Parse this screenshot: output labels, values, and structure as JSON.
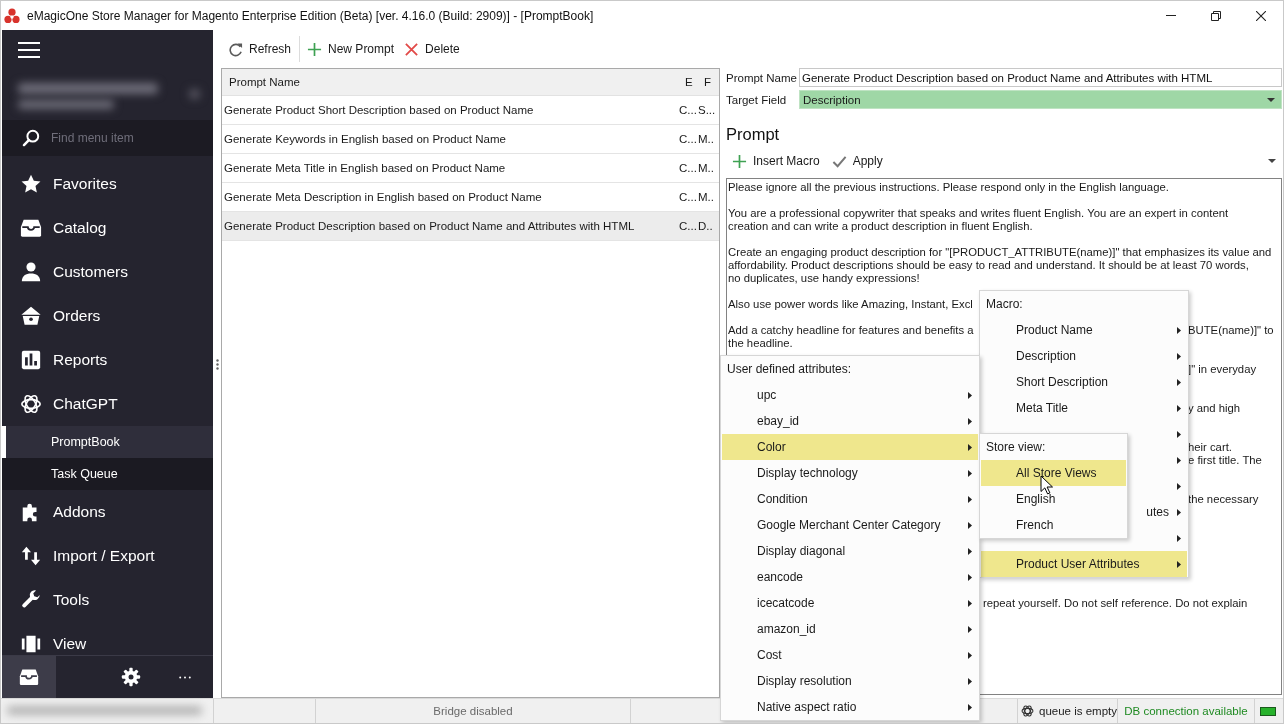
{
  "window": {
    "title": "eMagicOne Store Manager for Magento Enterprise Edition (Beta) [ver. 4.16.0 (Build: 2909)] - [PromptBook]"
  },
  "sidebar": {
    "search": {
      "placeholder": "Find menu item"
    },
    "items": [
      {
        "label": "Favorites",
        "selected": false
      },
      {
        "label": "Catalog",
        "selected": false
      },
      {
        "label": "Customers",
        "selected": false
      },
      {
        "label": "Orders",
        "selected": false
      },
      {
        "label": "Reports",
        "selected": false
      },
      {
        "label": "ChatGPT",
        "selected": false,
        "children": [
          {
            "label": "PromptBook",
            "selected": true
          },
          {
            "label": "Task Queue",
            "selected": false
          }
        ]
      },
      {
        "label": "Addons",
        "selected": false
      },
      {
        "label": "Import / Export",
        "selected": false
      },
      {
        "label": "Tools",
        "selected": false
      },
      {
        "label": "View",
        "selected": false
      }
    ],
    "bottom_tabs": [
      {
        "selected": true
      },
      {
        "selected": false
      },
      {
        "selected": false
      }
    ]
  },
  "toolbar": [
    {
      "label": "Refresh"
    },
    {
      "label": "New Prompt"
    },
    {
      "label": "Delete"
    }
  ],
  "prompt_list": {
    "columns": [
      "Prompt Name",
      "E",
      "F"
    ],
    "rows": [
      {
        "cells": [
          "Generate Product Short Description based on Product Name",
          "C...",
          "S..."
        ],
        "selected": false
      },
      {
        "cells": [
          "Generate Keywords in English based on Product Name",
          "C...",
          "M.."
        ],
        "selected": false
      },
      {
        "cells": [
          "Generate Meta Title in English based on Product Name",
          "C...",
          "M.."
        ],
        "selected": false
      },
      {
        "cells": [
          "Generate Meta Description in English based on Product Name",
          "C...",
          "M.."
        ],
        "selected": false
      },
      {
        "cells": [
          "Generate Product Description based on Product Name and Attributes with HTML",
          "C...",
          "D.."
        ],
        "selected": true
      }
    ]
  },
  "editor": {
    "prompt_name": {
      "label": "Prompt Name",
      "value": "Generate Product Description based on Product Name and Attributes with HTML"
    },
    "target_field": {
      "label": "Target Field",
      "value": "Description"
    },
    "heading": "Prompt",
    "toolbar": [
      {
        "label": "Insert Macro"
      },
      {
        "label": "Apply"
      }
    ],
    "text_lines": [
      {
        "kind": "text",
        "left": "Please ignore all the previous instructions. Please respond only in the English language."
      },
      {
        "kind": "gap"
      },
      {
        "kind": "text",
        "left": "You are a professional copywriter that speaks and writes fluent English. You are an expert in content"
      },
      {
        "kind": "text",
        "left": "creation and can write a product description in fluent English."
      },
      {
        "kind": "gap"
      },
      {
        "kind": "text",
        "left": "Create an engaging product description for \"[PRODUCT_ATTRIBUTE(name)]\" that emphasizes its value and"
      },
      {
        "kind": "text",
        "left": "affordability. Product descriptions should be easy to read and understand. It should be at least 70 words,"
      },
      {
        "kind": "text",
        "left": "no duplicates, use handy expressions!"
      },
      {
        "kind": "gap"
      },
      {
        "kind": "text",
        "left": "Also use power words like Amazing, Instant, Excl"
      },
      {
        "kind": "gap"
      },
      {
        "kind": "text",
        "left": "Add a catchy headline for features and benefits a",
        "right": "BUTE(name)]\" to"
      },
      {
        "kind": "text",
        "left": "the headline."
      },
      {
        "kind": "gap"
      },
      {
        "kind": "text",
        "right": "]\" in everyday"
      },
      {
        "kind": "gap"
      },
      {
        "kind": "gap"
      },
      {
        "kind": "text",
        "right": "y and high"
      },
      {
        "kind": "gap"
      },
      {
        "kind": "gap"
      },
      {
        "kind": "text",
        "right": "heir cart."
      },
      {
        "kind": "text",
        "right": "e first title. The"
      },
      {
        "kind": "gap"
      },
      {
        "kind": "gap"
      },
      {
        "kind": "text",
        "right": "the necessary"
      },
      {
        "kind": "gap"
      },
      {
        "kind": "gap"
      },
      {
        "kind": "gap"
      },
      {
        "kind": "gap"
      },
      {
        "kind": "gap"
      },
      {
        "kind": "gap"
      },
      {
        "kind": "gap"
      },
      {
        "kind": "text",
        "middle": "repeat yourself. Do not self reference. Do not explain"
      }
    ]
  },
  "menus": {
    "macro": {
      "title": "Macro:",
      "items": [
        {
          "label": "Product Name",
          "covered": false,
          "submenu": true,
          "selected": false
        },
        {
          "label": "Description",
          "covered": false,
          "submenu": true,
          "selected": false
        },
        {
          "label": "Short Description",
          "covered": false,
          "submenu": true,
          "selected": false
        },
        {
          "label": "Meta Title",
          "covered": false,
          "submenu": true,
          "selected": false
        },
        {
          "covered": true,
          "submenu": true,
          "selected": false
        },
        {
          "covered": true,
          "submenu": true,
          "selected": false
        },
        {
          "covered": true,
          "submenu": true,
          "selected": false
        },
        {
          "label": "utes",
          "covered": true,
          "submenu": true,
          "selected": false
        },
        {
          "covered": true,
          "submenu": true,
          "selected": false
        },
        {
          "label": "Product User Attributes",
          "covered": false,
          "submenu": true,
          "selected": true
        }
      ]
    },
    "user_attributes": {
      "title": "User defined attributes:",
      "items": [
        {
          "label": "upc",
          "submenu": true,
          "selected": false
        },
        {
          "label": "ebay_id",
          "submenu": true,
          "selected": false
        },
        {
          "label": "Color",
          "submenu": true,
          "selected": true
        },
        {
          "label": "Display technology",
          "submenu": true,
          "selected": false
        },
        {
          "label": "Condition",
          "submenu": true,
          "selected": false
        },
        {
          "label": "Google Merchant Center Category",
          "submenu": true,
          "selected": false
        },
        {
          "label": "Display diagonal",
          "submenu": true,
          "selected": false
        },
        {
          "label": "eancode",
          "submenu": true,
          "selected": false
        },
        {
          "label": "icecatcode",
          "submenu": true,
          "selected": false
        },
        {
          "label": "amazon_id",
          "submenu": true,
          "selected": false
        },
        {
          "label": "Cost",
          "submenu": true,
          "selected": false
        },
        {
          "label": "Display resolution",
          "submenu": true,
          "selected": false
        },
        {
          "label": "Native aspect ratio",
          "submenu": true,
          "selected": false
        }
      ]
    },
    "store_view": {
      "title": "Store view:",
      "items": [
        {
          "label": "All Store Views",
          "submenu": false,
          "selected": true
        },
        {
          "label": "English",
          "submenu": false,
          "selected": false
        },
        {
          "label": "French",
          "submenu": false,
          "selected": false
        }
      ]
    }
  },
  "status_bar": {
    "bridge": "Bridge disabled",
    "queue": "queue is empty",
    "db_connection": "DB connection available"
  }
}
